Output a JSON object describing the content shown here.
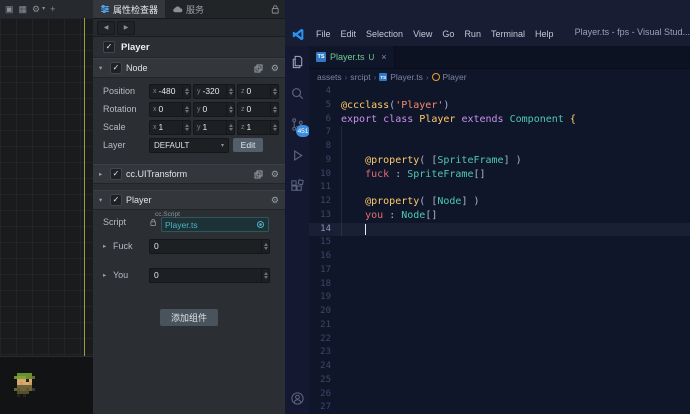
{
  "glyphs": {
    "collapse_down": "▾",
    "collapse_right": "▸",
    "check": "✓",
    "gear": "⚙",
    "back": "◀",
    "forward": "▶",
    "caret_down": "▾",
    "close": "×",
    "crumb_sep": "›",
    "toolbar_box": "▣",
    "toolbar_grid": "▦",
    "plus": "+"
  },
  "colors": {
    "ts_blue": "#3178c6",
    "git_green": "#73c991",
    "badge_blue": "#3c8de0",
    "script_teal": "#4fb3c6",
    "class_symbol_orange": "#ee9d28"
  },
  "cocos": {
    "inspector": {
      "tabs": [
        {
          "label": "属性检查器",
          "active": true
        },
        {
          "label": "服务",
          "active": false
        }
      ],
      "node": {
        "name": "Player"
      },
      "node_section": {
        "title": "Node"
      },
      "axes": {
        "x": "x",
        "y": "y",
        "z": "z"
      },
      "position": {
        "label": "Position",
        "x": "-480",
        "y": "-320",
        "z": "0"
      },
      "rotation": {
        "label": "Rotation",
        "x": "0",
        "y": "0",
        "z": "0"
      },
      "scale": {
        "label": "Scale",
        "x": "1",
        "y": "1",
        "z": "1"
      },
      "layer": {
        "label": "Layer",
        "value": "DEFAULT",
        "edit": "Edit"
      },
      "uitransform_section": {
        "title": "cc.UITransform"
      },
      "player_section": {
        "title": "Player"
      },
      "script": {
        "label": "Script",
        "hint": "cc.Script",
        "value": "Player.ts"
      },
      "fuck": {
        "label": "Fuck",
        "value": "0"
      },
      "you": {
        "label": "You",
        "value": "0"
      },
      "add_component": "添加组件"
    }
  },
  "vscode": {
    "window_title": "Player.ts - fps - Visual Stud...",
    "menu": [
      "File",
      "Edit",
      "Selection",
      "View",
      "Go",
      "Run",
      "Terminal",
      "Help"
    ],
    "tab": {
      "icon": "TS",
      "label": "Player.ts",
      "git": "U"
    },
    "breadcrumbs": [
      {
        "label": "assets"
      },
      {
        "label": "srcipt"
      },
      {
        "label": "Player.ts",
        "icon": "TS"
      },
      {
        "label": "Player",
        "icon": "class"
      }
    ],
    "activity": {
      "badge": "451"
    },
    "editor": {
      "cursor_line": 14,
      "lines": [
        {
          "n": 4,
          "parts": []
        },
        {
          "n": 5,
          "parts": [
            [
              "dec",
              "@ccclass"
            ],
            [
              "pun",
              "("
            ],
            [
              "str",
              "'Player'"
            ],
            [
              "pun",
              ")"
            ]
          ]
        },
        {
          "n": 6,
          "parts": [
            [
              "kw",
              "export "
            ],
            [
              "kw",
              "class "
            ],
            [
              "cls",
              "Player "
            ],
            [
              "kw",
              "extends "
            ],
            [
              "type",
              "Component "
            ],
            [
              "brace",
              "{"
            ]
          ]
        },
        {
          "n": 7,
          "parts": []
        },
        {
          "n": 8,
          "parts": []
        },
        {
          "n": 9,
          "parts": [
            [
              "pun",
              "    "
            ],
            [
              "dec",
              "@property"
            ],
            [
              "pun",
              "( ["
            ],
            [
              "type",
              "SpriteFrame"
            ],
            [
              "pun",
              "] )"
            ]
          ]
        },
        {
          "n": 10,
          "parts": [
            [
              "pun",
              "    "
            ],
            [
              "var",
              "fuck "
            ],
            [
              "pun",
              ": "
            ],
            [
              "type",
              "SpriteFrame"
            ],
            [
              "pun",
              "[]"
            ]
          ]
        },
        {
          "n": 11,
          "parts": []
        },
        {
          "n": 12,
          "parts": [
            [
              "pun",
              "    "
            ],
            [
              "dec",
              "@property"
            ],
            [
              "pun",
              "( ["
            ],
            [
              "type",
              "Node"
            ],
            [
              "pun",
              "] )"
            ]
          ]
        },
        {
          "n": 13,
          "parts": [
            [
              "pun",
              "    "
            ],
            [
              "var",
              "you "
            ],
            [
              "pun",
              ": "
            ],
            [
              "type",
              "Node"
            ],
            [
              "pun",
              "[]"
            ]
          ]
        },
        {
          "n": 14,
          "parts": [
            [
              "pun",
              "    "
            ]
          ],
          "cursor": true
        },
        {
          "n": 15,
          "parts": []
        },
        {
          "n": 16,
          "parts": []
        },
        {
          "n": 17,
          "parts": []
        },
        {
          "n": 18,
          "parts": []
        },
        {
          "n": 19,
          "parts": []
        },
        {
          "n": 20,
          "parts": []
        },
        {
          "n": 21,
          "parts": []
        },
        {
          "n": 22,
          "parts": []
        },
        {
          "n": 23,
          "parts": []
        },
        {
          "n": 24,
          "parts": []
        },
        {
          "n": 25,
          "parts": []
        },
        {
          "n": 26,
          "parts": []
        },
        {
          "n": 27,
          "parts": []
        }
      ]
    }
  }
}
